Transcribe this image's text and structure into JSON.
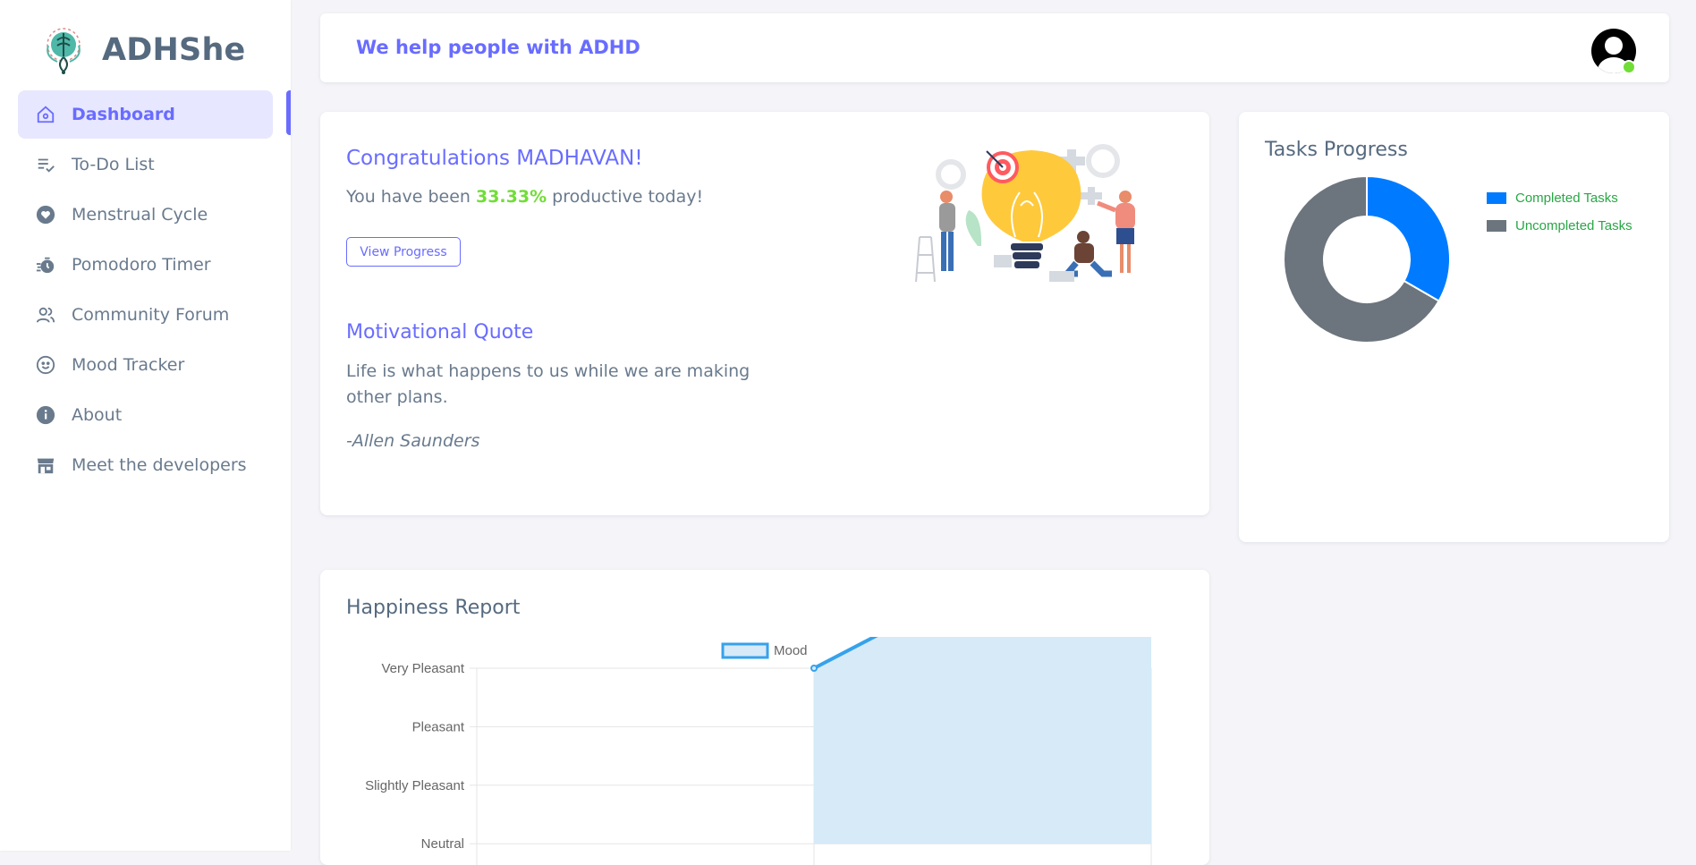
{
  "brand": {
    "name": "ADHShe"
  },
  "sidebar": {
    "items": [
      {
        "label": "Dashboard",
        "icon": "home-icon",
        "active": true
      },
      {
        "label": "To-Do List",
        "icon": "checklist-icon"
      },
      {
        "label": "Menstrual Cycle",
        "icon": "heart-icon"
      },
      {
        "label": "Pomodoro Timer",
        "icon": "stopwatch-icon"
      },
      {
        "label": "Community Forum",
        "icon": "users-icon"
      },
      {
        "label": "Mood Tracker",
        "icon": "smile-icon"
      },
      {
        "label": "About",
        "icon": "info-icon"
      },
      {
        "label": "Meet the developers",
        "icon": "store-icon"
      }
    ]
  },
  "navbar": {
    "title": "We help people with ADHD"
  },
  "welcome": {
    "congrats": "Congratulations MADHAVAN!",
    "productive_prefix": "You have been ",
    "productive_value": "33.33%",
    "productive_suffix": " productive today!",
    "button": "View Progress",
    "quote_title": "Motivational Quote",
    "quote": "Life is what happens to us while we are making other plans.",
    "author": "-Allen Saunders"
  },
  "tasks": {
    "title": "Tasks Progress",
    "chart_data": {
      "type": "pie",
      "categories": [
        "Completed Tasks",
        "Uncompleted Tasks"
      ],
      "values": [
        33.33,
        66.67
      ],
      "colors": [
        "#007bff",
        "#6c757d"
      ],
      "legend": "right"
    }
  },
  "happiness": {
    "title": "Happiness Report",
    "chart_data": {
      "type": "area",
      "series": [
        {
          "name": "Mood",
          "values": [
            null,
            3,
            6
          ]
        }
      ],
      "y_categories": [
        "Neutral",
        "Slightly Pleasant",
        "Pleasant",
        "Very Pleasant"
      ],
      "legend": "top",
      "grid": true,
      "colors": {
        "line": "#36a2eb",
        "fill": "#d6eaf8"
      }
    }
  }
}
